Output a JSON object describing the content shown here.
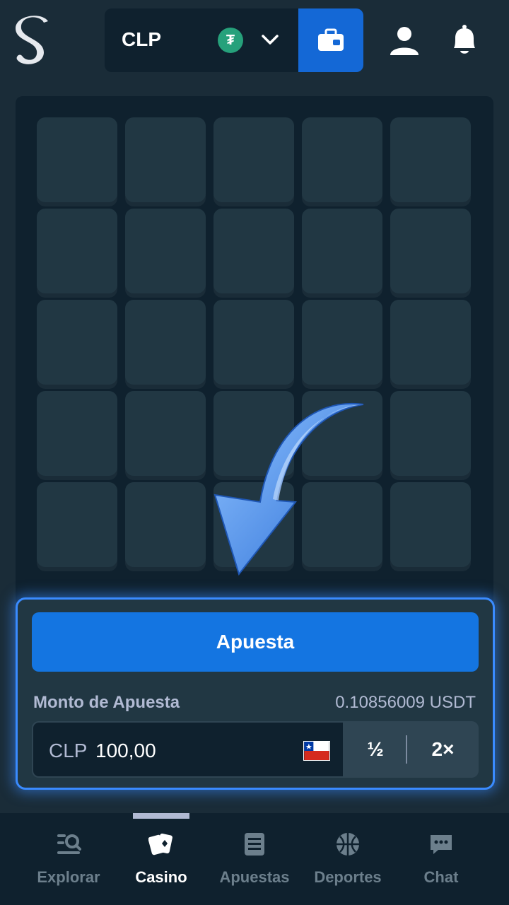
{
  "header": {
    "currency": "CLP",
    "coin_icon": "tether-icon",
    "wallet_icon": "wallet-icon",
    "user_icon": "user-icon",
    "bell_icon": "bell-icon"
  },
  "game": {
    "rows": 5,
    "cols": 5
  },
  "bet_panel": {
    "bet_button_label": "Apuesta",
    "amount_label": "Monto de Apuesta",
    "amount_converted": "0.10856009 USDT",
    "amount_currency": "CLP",
    "amount_value": "100,00",
    "half_label": "½",
    "double_label": "2×"
  },
  "nav": {
    "items": [
      {
        "label": "Explorar",
        "icon": "explore-icon",
        "active": false
      },
      {
        "label": "Casino",
        "icon": "casino-cards-icon",
        "active": true
      },
      {
        "label": "Apuestas",
        "icon": "bets-list-icon",
        "active": false
      },
      {
        "label": "Deportes",
        "icon": "basketball-icon",
        "active": false
      },
      {
        "label": "Chat",
        "icon": "chat-icon",
        "active": false
      }
    ]
  },
  "colors": {
    "accent": "#1475e1",
    "wallet": "#1468d6",
    "background": "#1a2c38",
    "tile": "#213743"
  }
}
